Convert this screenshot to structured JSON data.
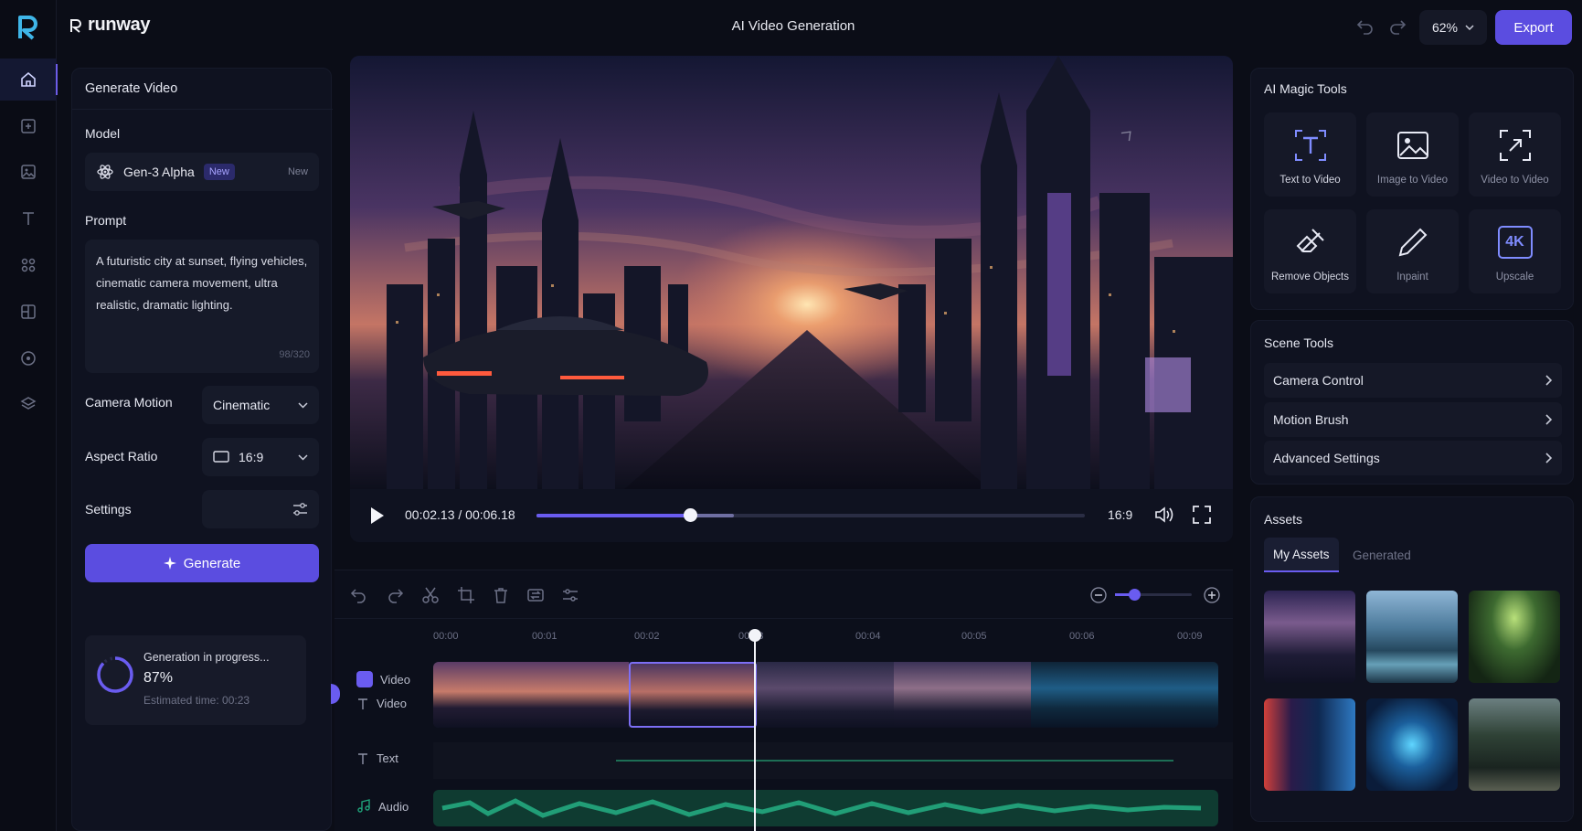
{
  "app": {
    "brand": "runway",
    "title": "AI Video Generation",
    "zoom": "62%",
    "export_label": "Export"
  },
  "sidebar": {
    "items": [
      "home-icon",
      "add-media-icon",
      "image-icon",
      "text-icon",
      "effects-icon",
      "layout-icon",
      "record-icon",
      "layers-icon"
    ],
    "active": 0
  },
  "left": {
    "title": "Generate Video",
    "model_label": "Model",
    "model_name": "Gen-3 Alpha",
    "model_badge": "New",
    "model_new": "New",
    "prompt_label": "Prompt",
    "prompt_text": "A futuristic city at sunset, flying vehicles, cinematic camera movement, ultra realistic, dramatic lighting.",
    "prompt_count": "98/320",
    "camera_label": "Camera Motion",
    "camera_value": "Cinematic",
    "aspect_label": "Aspect Ratio",
    "aspect_value": "16:9",
    "settings_label": "Settings",
    "generate_label": "Generate",
    "progress_title": "Generation in progress...",
    "progress_percent": "87%",
    "progress_value": 0.87,
    "progress_eta": "Estimated time: 00:23"
  },
  "player": {
    "time": "00:02.13 / 00:06.18",
    "ratio": "16:9",
    "progress": 0.28,
    "buffered": 0.36
  },
  "timeline": {
    "ticks": [
      "00:00",
      "00:01",
      "00:02",
      "00:03",
      "00:04",
      "00:05",
      "00:06",
      "00:09"
    ],
    "tracks": {
      "video_selected": "Video",
      "video": "Video",
      "text": "Text",
      "audio": "Audio"
    },
    "zoom_level": 0.25
  },
  "right": {
    "magic_title": "AI Magic Tools",
    "tools": [
      "Text to Video",
      "Image to Video",
      "Video to Video",
      "Remove Objects",
      "Inpaint",
      "Upscale"
    ],
    "upscale_badge": "4K",
    "scene_title": "Scene Tools",
    "scene_items": [
      "Camera Control",
      "Motion Brush",
      "Advanced Settings"
    ],
    "assets_title": "Assets",
    "tab_my": "My Assets",
    "tab_generated": "Generated"
  },
  "colors": {
    "accent": "#5b4de0",
    "background": "#0b0d17",
    "panel": "#0f1220",
    "audio": "#1fa37a"
  }
}
